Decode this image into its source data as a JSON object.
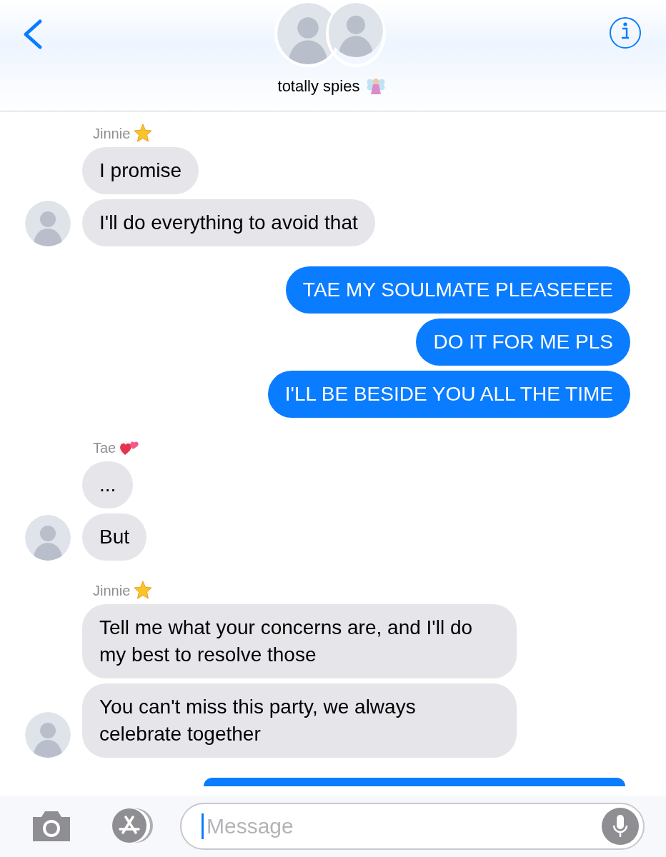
{
  "header": {
    "title": "totally spies",
    "title_badge": {
      "kind": "fairy"
    }
  },
  "groups": [
    {
      "kind": "incoming",
      "sender": "Jinnie",
      "badge": {
        "kind": "star"
      },
      "messages": [
        "I promise",
        "I'll do everything to avoid that"
      ]
    },
    {
      "kind": "outgoing",
      "messages": [
        "TAE MY SOULMATE PLEASEEEE",
        "DO IT FOR ME PLS",
        "I'LL BE BESIDE YOU ALL THE TIME"
      ]
    },
    {
      "kind": "incoming",
      "sender": "Tae",
      "badge": {
        "kind": "hearts"
      },
      "messages": [
        "...",
        "But"
      ]
    },
    {
      "kind": "incoming",
      "sender": "Jinnie",
      "badge": {
        "kind": "star"
      },
      "messages": [
        "Tell me what your concerns are, and I'll do my best to resolve those",
        "You can't miss this party, we always celebrate together"
      ]
    },
    {
      "kind": "cut"
    }
  ],
  "composer": {
    "placeholder": "Message"
  }
}
